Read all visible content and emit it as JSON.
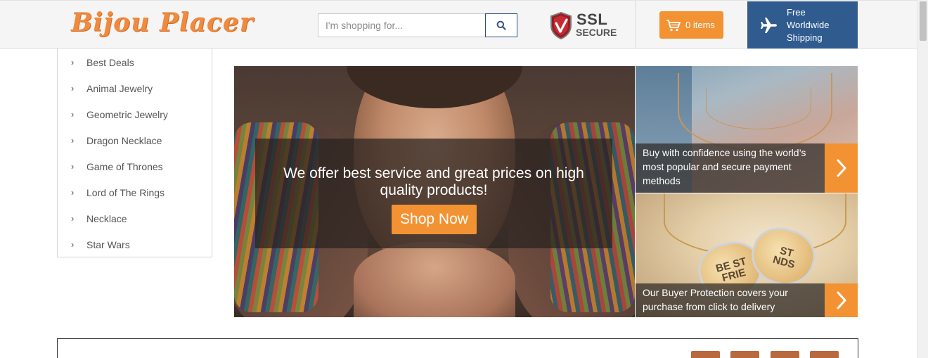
{
  "header": {
    "logo": "Bijou Placer",
    "search": {
      "placeholder": "I'm shopping for...",
      "value": "",
      "button_icon": "search-icon"
    },
    "ssl": {
      "line1": "SSL",
      "line2": "SECURE",
      "icon": "shield-check-icon"
    },
    "cart": {
      "label": "0 items",
      "icon": "cart-icon"
    },
    "shipping": {
      "label": "Free Worldwide Shipping",
      "icon": "airplane-icon"
    }
  },
  "sidebar": {
    "items": [
      {
        "label": "Best Deals"
      },
      {
        "label": "Animal Jewelry"
      },
      {
        "label": "Geometric Jewelry"
      },
      {
        "label": "Dragon Necklace"
      },
      {
        "label": "Game of Thrones"
      },
      {
        "label": "Lord of The Rings"
      },
      {
        "label": "Necklace"
      },
      {
        "label": "Star Wars"
      }
    ],
    "chevron": "›"
  },
  "hero": {
    "headline": "We offer best service and great prices on high quality products!",
    "button_label": "Shop Now"
  },
  "promos": [
    {
      "text": "Buy with confidence using the world’s most popular and secure payment methods",
      "arrow": "chevron-right-icon"
    },
    {
      "text": "Our Buyer Protection covers your purchase from click to delivery",
      "arrow": "chevron-right-icon",
      "image_text_left": "BE ST FRIE",
      "image_text_right": "ST NDS"
    }
  ],
  "colors": {
    "accent": "#f39233",
    "shipping_bg": "#2f5b8f",
    "logo": "#f08a3e",
    "search_border": "#2d4f86"
  }
}
